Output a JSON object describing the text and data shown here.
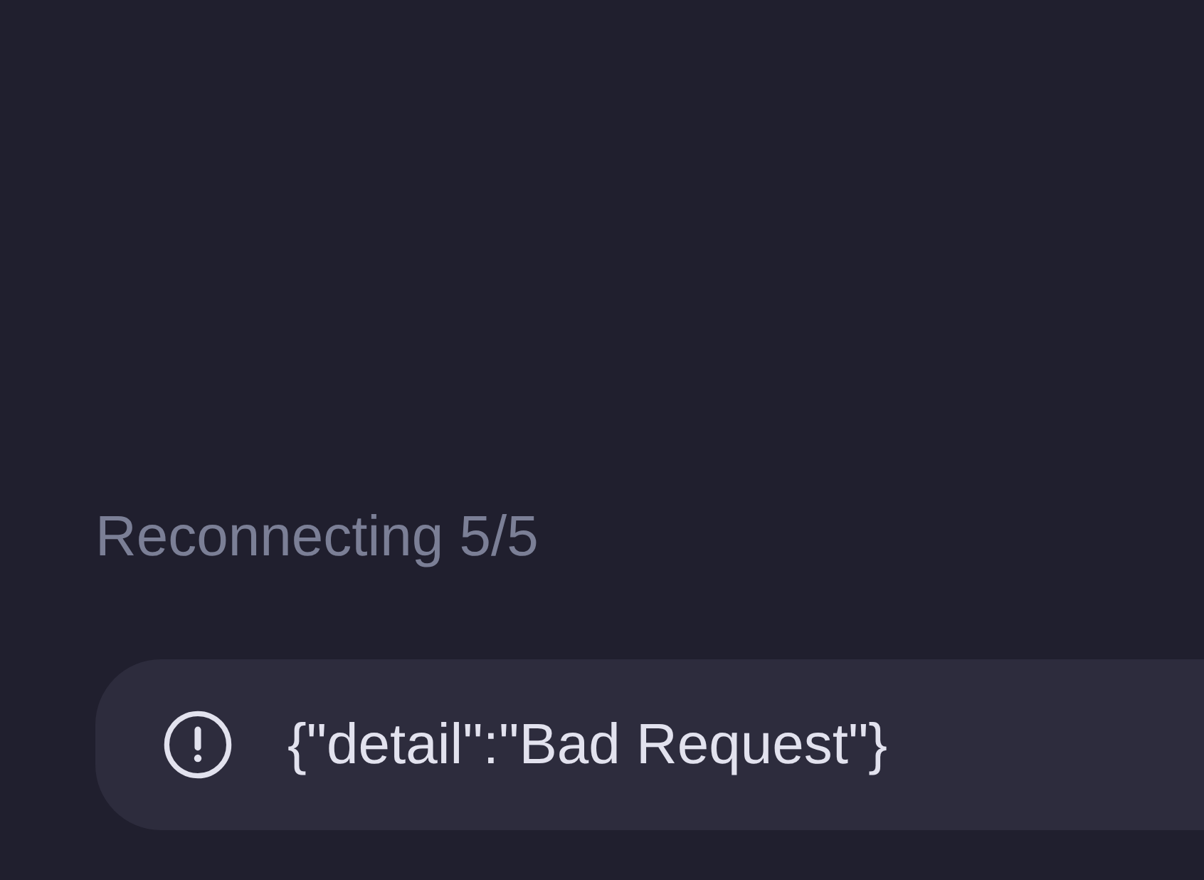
{
  "status": {
    "text": "Reconnecting 5/5"
  },
  "error_toast": {
    "message": "{\"detail\":\"Bad Request\"}"
  }
}
